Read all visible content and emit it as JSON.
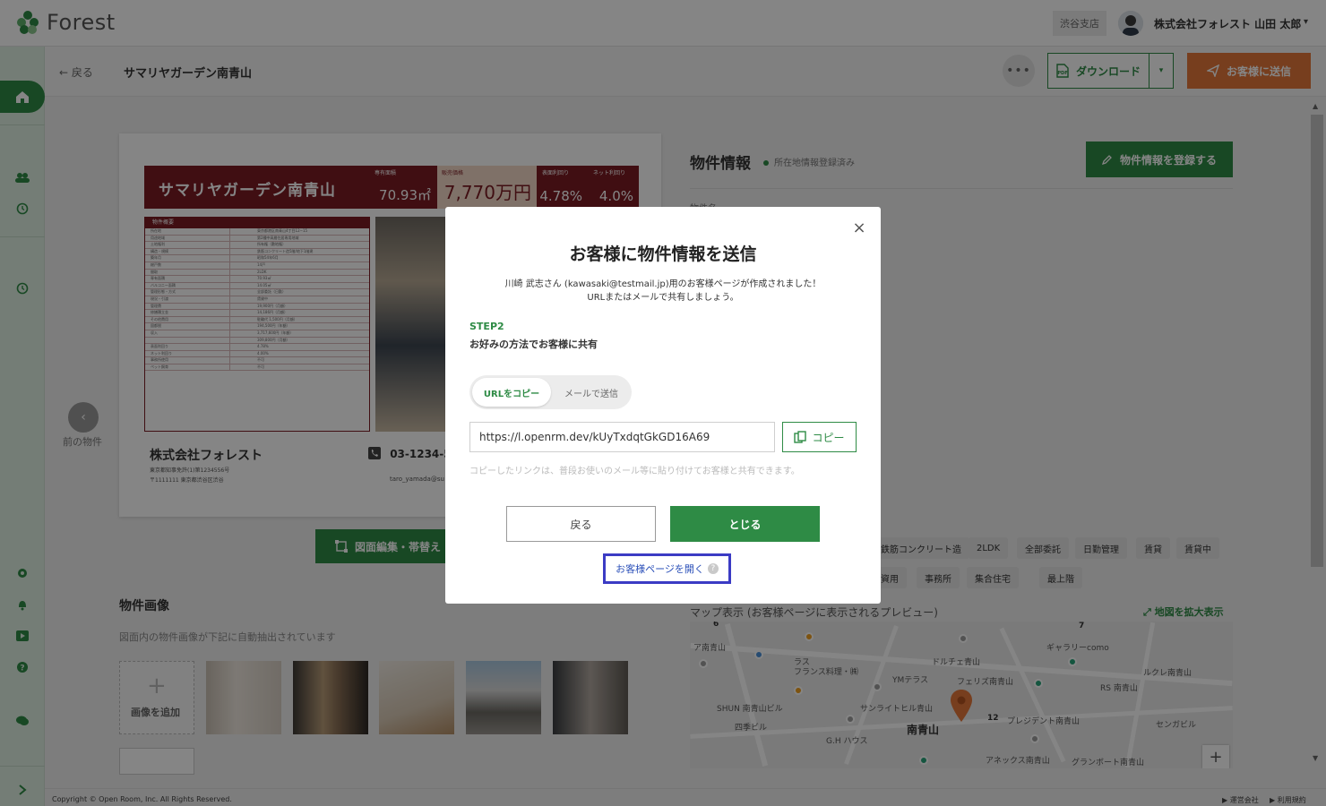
{
  "app": {
    "name": "Forest"
  },
  "topbar": {
    "branch": "渋谷支店",
    "user_name": "株式会社フォレスト 山田 太郎",
    "user_caret": "▾"
  },
  "header": {
    "back_label": "← 戻る",
    "title": "サマリヤガーデン南青山",
    "more_label": "•••",
    "download_label": "ダウンロード",
    "download_caret": "▾",
    "send_label": "お客様に送信"
  },
  "flyer": {
    "name": "サマリヤガーデン南青山",
    "boxes": [
      {
        "label": "専有面積",
        "value": "70.93㎡"
      },
      {
        "label": "販売価格",
        "value": "7,770万円"
      },
      {
        "label": "表面利回り",
        "value": "4.78%"
      },
      {
        "label": "ネット利回り",
        "value": "4.0%"
      }
    ],
    "table_title": "物件概要",
    "rows": [
      [
        "所在地",
        "東京都港区南青山4丁目12−15"
      ],
      [
        "用途地域",
        "第2種中高層住居専用地域"
      ],
      [
        "土地権利",
        "所有権（敷地権）"
      ],
      [
        "構造・規模",
        "鉄筋コンクリート造5階/地下1階建"
      ],
      [
        "築年月",
        "昭和54年6月"
      ],
      [
        "総戸数",
        "14戸"
      ],
      [
        "間取",
        "2LDK"
      ],
      [
        "専有面積",
        "70.93㎡"
      ],
      [
        "バルコニー面積",
        "14.05㎡"
      ],
      [
        "管理形態・方式",
        "全部委託（日勤）"
      ],
      [
        "現況・引渡",
        "賃貸中"
      ],
      [
        "管理費",
        "19,900円（月額）"
      ],
      [
        "修繕積立金",
        "14,186円（月額）"
      ],
      [
        "その他費用",
        "駐輪代 1,500円（月額）"
      ],
      [
        "固都税",
        "194,500円（年額）"
      ],
      [
        "収入",
        "3,717,600円（年額）"
      ],
      [
        "",
        "309,800円（月額）"
      ],
      [
        "表面利回り",
        "4.78%"
      ],
      [
        "ネット利回り",
        "4.00%"
      ],
      [
        "事務所使用",
        "不可"
      ],
      [
        "ペット飼育",
        "不可"
      ]
    ],
    "company": "株式会社フォレスト",
    "license": "東京都知事免許(1)第1234556号",
    "address": "〒1111111 東京都渋谷区渋谷",
    "phone": "03-1234-56",
    "mail": "taro_yamada@su"
  },
  "prev": {
    "icon": "‹",
    "label": "前の物件"
  },
  "edit_button": "図面編集・帯替え",
  "images": {
    "title": "物件画像",
    "note": "図面内の物件画像が下記に自動抽出されています",
    "add_label": "画像を追加",
    "add_plus": "+"
  },
  "info": {
    "title": "物件情報",
    "status": "所在地情報登録済み",
    "register_label": "物件情報を登録する",
    "field_label": "物件名",
    "tags_row1": [
      "鉄筋コンクリート造",
      "2LDK",
      "全部委託",
      "日勤管理",
      "賃貸",
      "賃貸中"
    ],
    "tags_row2": [
      "資用",
      "事務所",
      "集合住宅",
      "最上階"
    ]
  },
  "map": {
    "title": "マップ表示 (お客様ページに表示されるプレビュー)",
    "expand_label": "地図を拡大表示",
    "labels": [
      "ア南青山",
      "ラス",
      "フランス料理・㈱",
      "YMテラス",
      "ドルチェ青山",
      "フェリズ南青山",
      "ギャラリーcomo",
      "ルクレ南青山",
      "RS 南青山",
      "SHUN 南青山ビル",
      "サンライトヒル青山",
      "四季ビル",
      "G.H ハウス",
      "南青山",
      "12",
      "プレジデント南青山",
      "センガビル",
      "アネックス南青山",
      "グランボート南青山",
      "7",
      "6"
    ],
    "zoom_in": "+"
  },
  "footer": {
    "copyright": "Copyright © Open Room, Inc. All Rights Reserved.",
    "links": [
      "▶ 運営会社",
      "▶ 利用規約"
    ]
  },
  "modal": {
    "title": "お客様に物件情報を送信",
    "message_line1": "川崎 武志さん (kawasaki@testmail.jp)用のお客様ページが作成されました！",
    "message_line2": "URLまたはメールで共有しましょう。",
    "step_label": "STEP2",
    "step_desc": "お好みの方法でお客様に共有",
    "tab_url": "URLをコピー",
    "tab_mail": "メールで送信",
    "url_value": "https://l.openrm.dev/kUyTxdqtGkGD16A69",
    "copy_label": "コピー",
    "copy_note": "コピーしたリンクは、普段お使いのメール等に貼り付けてお客様と共有できます。",
    "back_label": "戻る",
    "close_label": "とじる",
    "open_page_label": "お客様ページを開く",
    "help_mark": "?",
    "close_icon": "×"
  },
  "colors": {
    "brand_green": "#2e8b45",
    "send_orange": "#e4773a",
    "flyer_maroon": "#7b1c24",
    "highlight_border": "#3b3bc4"
  }
}
